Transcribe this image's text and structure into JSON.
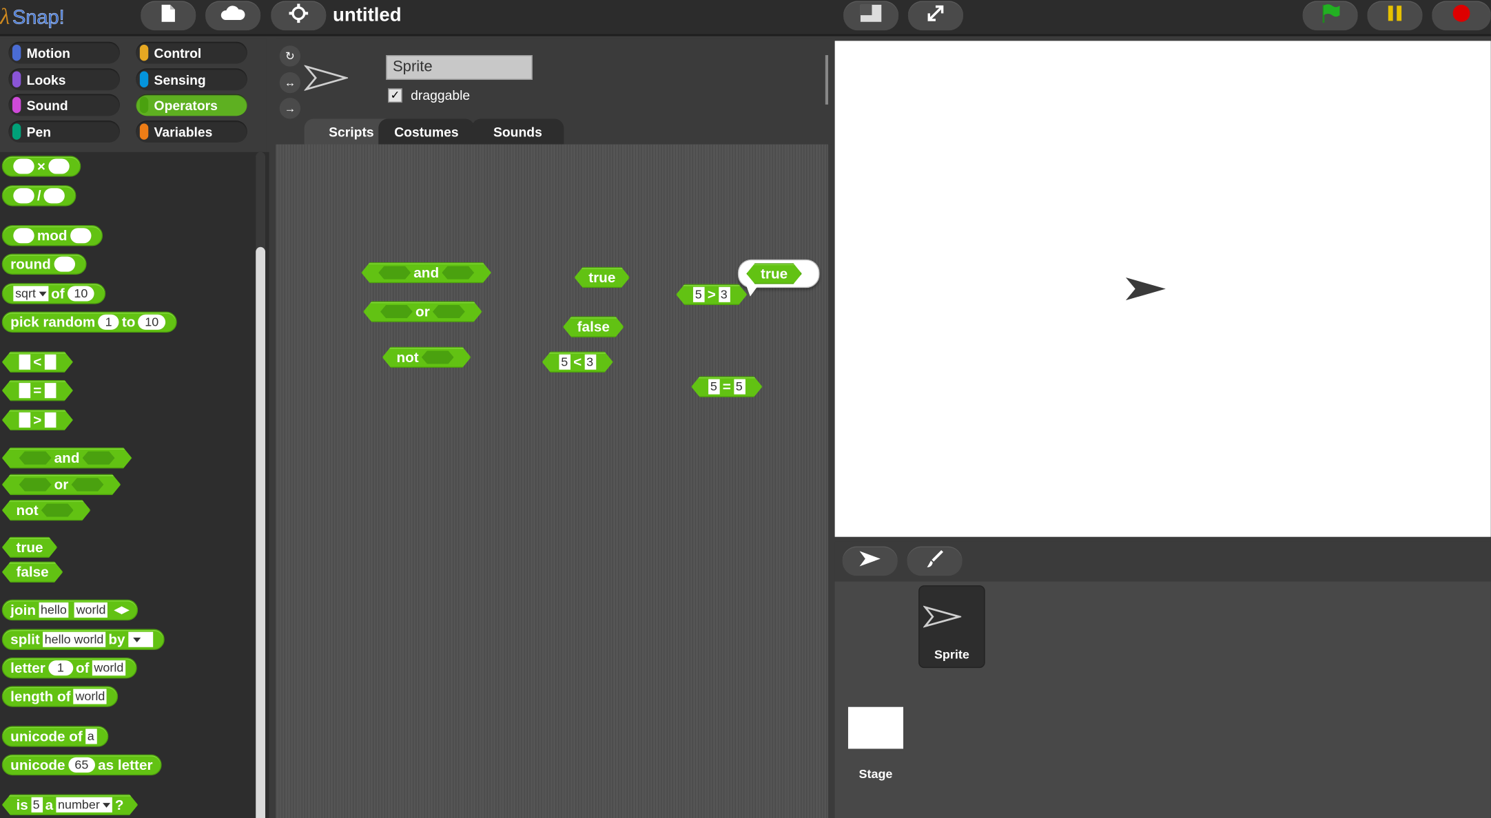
{
  "app": {
    "logo_text": "Snap!",
    "project_title": "untitled"
  },
  "toolbar": {
    "file_icon": "file-icon",
    "cloud_icon": "cloud-icon",
    "settings_icon": "gear-icon",
    "stage_size_icon": "normal-stage-icon",
    "fullscreen_icon": "fullscreen-icon",
    "green_flag_icon": "green-flag-icon",
    "pause_icon": "pause-icon",
    "stop_icon": "stop-icon"
  },
  "categories": [
    {
      "label": "Motion",
      "color": "#4a6cd4"
    },
    {
      "label": "Control",
      "color": "#e6a822"
    },
    {
      "label": "Looks",
      "color": "#8a55d7"
    },
    {
      "label": "Sensing",
      "color": "#0494dc"
    },
    {
      "label": "Sound",
      "color": "#cf4ad9"
    },
    {
      "label": "Operators",
      "color": "#62c213"
    },
    {
      "label": "Pen",
      "color": "#00a178"
    },
    {
      "label": "Variables",
      "color": "#ee7d16"
    }
  ],
  "active_category": "Operators",
  "palette": {
    "times": "×",
    "divide": "/",
    "mod": "mod",
    "round": "round",
    "sqrt": {
      "fn": "sqrt",
      "of": "of",
      "value": "10"
    },
    "pick_random": {
      "label": "pick random",
      "from": "1",
      "to_label": "to",
      "to": "10"
    },
    "lt": "<",
    "eq": "=",
    "gt": ">",
    "and": "and",
    "or": "or",
    "not": "not",
    "true": "true",
    "false": "false",
    "join": {
      "label": "join",
      "a": "hello",
      "b": "world"
    },
    "split": {
      "label": "split",
      "text": "hello world",
      "by": "by",
      "sep": " "
    },
    "letter": {
      "label": "letter",
      "index": "1",
      "of": "of",
      "text": "world"
    },
    "length": {
      "label": "length of",
      "text": "world"
    },
    "unicode_of": {
      "label": "unicode of",
      "text": "a"
    },
    "unicode_as": {
      "label": "unicode",
      "value": "65",
      "suffix": "as letter"
    },
    "is_a": {
      "label": "is",
      "value": "5",
      "a": "a",
      "type": "number",
      "q": "?"
    }
  },
  "sprite": {
    "name": "Sprite",
    "draggable_label": "draggable",
    "draggable_checked": "✓"
  },
  "tabs": [
    "Scripts",
    "Costumes",
    "Sounds"
  ],
  "active_tab": "Scripts",
  "scripts": {
    "and": "and",
    "or": "or",
    "not": "not",
    "true": "true",
    "false": "false",
    "lt": {
      "a": "5",
      "op": "<",
      "b": "3"
    },
    "gt": {
      "a": "5",
      "op": ">",
      "b": "3"
    },
    "eq": {
      "a": "5",
      "op": "=",
      "b": "5"
    },
    "bubble": "true"
  },
  "corral": {
    "sprite_label": "Sprite",
    "stage_label": "Stage",
    "turtle_icon": "turtle-icon",
    "paint_icon": "paintbrush-icon"
  }
}
